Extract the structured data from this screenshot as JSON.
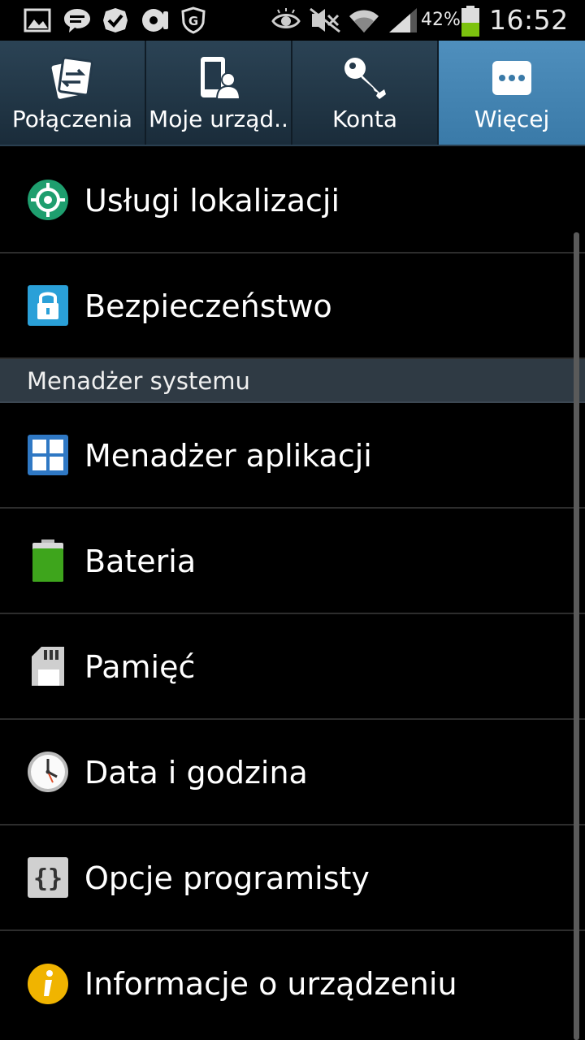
{
  "status_bar": {
    "battery_percent": "42%",
    "time": "16:52",
    "icons": [
      "gallery-icon",
      "chat-icon",
      "check-icon",
      "disc-icon",
      "shield-g-icon",
      "eye-icon",
      "mute-icon",
      "wifi-icon",
      "signal-icon",
      "battery-icon"
    ]
  },
  "tabs": [
    {
      "label": "Połączenia",
      "icon": "connections-icon",
      "active": false
    },
    {
      "label": "Moje urząd..",
      "icon": "my-device-icon",
      "active": false
    },
    {
      "label": "Konta",
      "icon": "key-icon",
      "active": false
    },
    {
      "label": "Więcej",
      "icon": "more-icon",
      "active": true
    }
  ],
  "list": {
    "location": "Usługi lokalizacji",
    "security": "Bezpieczeństwo",
    "section_system": "Menadżer systemu",
    "app_manager": "Menadżer aplikacji",
    "battery": "Bateria",
    "storage": "Pamięć",
    "date_time": "Data i godzina",
    "developer": "Opcje programisty",
    "about": "Informacje o urządzeniu"
  },
  "colors": {
    "tab_bar": "#1f3444",
    "tab_active": "#4585b3",
    "section_header": "#2f3a44",
    "location_icon": "#1e9e6e",
    "security_icon": "#2aa0d8",
    "app_manager_icon": "#2f78c4",
    "battery_green": "#3ea51c",
    "info_icon": "#f0b400"
  }
}
